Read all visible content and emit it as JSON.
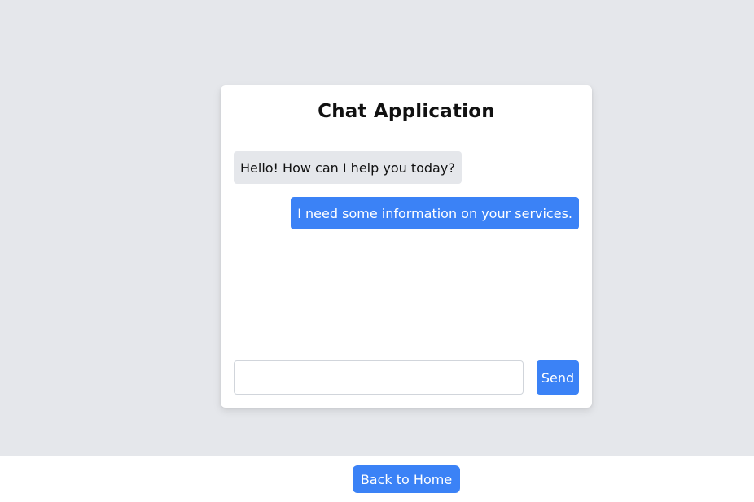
{
  "app": {
    "title": "Chat Application"
  },
  "messages": [
    {
      "sender": "bot",
      "text": "Hello! How can I help you today?"
    },
    {
      "sender": "user",
      "text": "I need some information on your services."
    }
  ],
  "composer": {
    "input_value": "",
    "input_placeholder": "",
    "send_label": "Send"
  },
  "footer": {
    "back_label": "Back to Home"
  },
  "colors": {
    "page_background": "#e5e7eb",
    "accent": "#3b82f6",
    "incoming_bubble": "#e5e7eb",
    "card_background": "#ffffff"
  }
}
